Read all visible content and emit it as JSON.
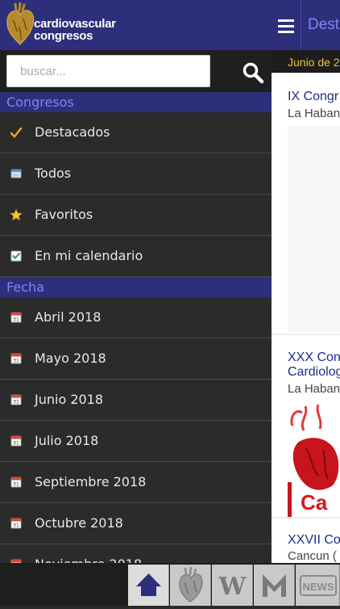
{
  "app": {
    "logo_line1": "cardiovascular",
    "logo_line2": "congresos"
  },
  "search": {
    "placeholder": "buscar..."
  },
  "sidebar": {
    "congresos_header": "Congresos",
    "congresos_items": [
      {
        "label": "Destacados",
        "icon": "check-icon"
      },
      {
        "label": "Todos",
        "icon": "list-icon"
      },
      {
        "label": "Favoritos",
        "icon": "star-icon"
      },
      {
        "label": "En mi calendario",
        "icon": "calendar-check-icon"
      }
    ],
    "fecha_header": "Fecha",
    "fecha_items": [
      {
        "label": "Abril 2018",
        "icon": "calendar-icon"
      },
      {
        "label": "Mayo 2018",
        "icon": "calendar-icon"
      },
      {
        "label": "Junio 2018",
        "icon": "calendar-icon"
      },
      {
        "label": "Julio 2018",
        "icon": "calendar-icon"
      },
      {
        "label": "Septiembre 2018",
        "icon": "calendar-icon"
      },
      {
        "label": "Octubre 2018",
        "icon": "calendar-icon"
      },
      {
        "label": "Noviembre 2018",
        "icon": "calendar-icon"
      }
    ]
  },
  "main": {
    "title": "Dest",
    "date_group": "Junio de 2",
    "cards": [
      {
        "title": "IX Congr",
        "location": "La Haban"
      },
      {
        "title_line1": "XXX Con",
        "title_line2": "Cardiolog",
        "location": "La Haban",
        "image_text": "Ca"
      },
      {
        "title": "XXVII Co",
        "location": "Cancun ("
      }
    ]
  },
  "bottom_tabs": [
    {
      "name": "home-tab",
      "icon": "home-icon",
      "active": true
    },
    {
      "name": "heart-tab",
      "icon": "heart-icon",
      "active": false
    },
    {
      "name": "w-tab",
      "icon": "w-icon",
      "label": "W",
      "active": false
    },
    {
      "name": "m-tab",
      "icon": "m-icon",
      "active": false
    },
    {
      "name": "news-tab",
      "icon": "news-icon",
      "label": "NEWS",
      "active": false
    }
  ],
  "colors": {
    "brand_navy": "#2d2f7a",
    "section_text": "#7e86f5",
    "date_text": "#e8c33a",
    "card_title": "#1f2b8c",
    "check_orange": "#f0a020"
  }
}
